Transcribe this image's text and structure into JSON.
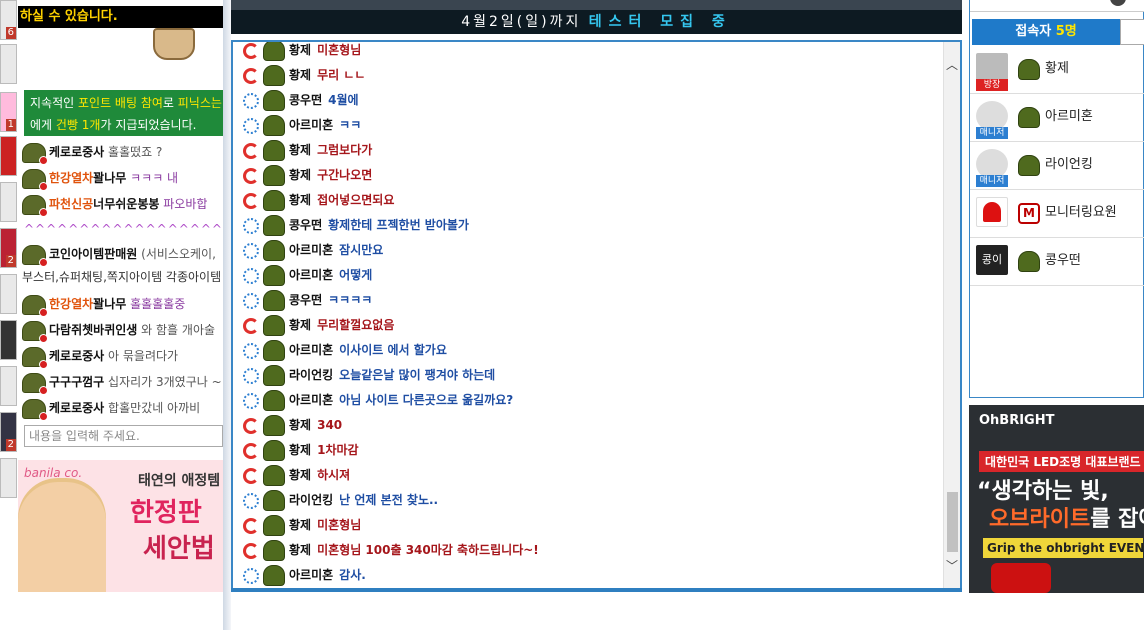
{
  "left": {
    "notice_top": "하실 수 있습니다.",
    "badges": [
      "6",
      "1",
      "2",
      "2"
    ],
    "green_notice": {
      "line1_prefix": "지속적인 ",
      "line1_hl": "포인트 배팅 참여",
      "line1_mid": "로 ",
      "line1_hl2": "피닉스는",
      "line2_prefix": "에게 ",
      "line2_hl": "건빵 1개",
      "line2_suffix": "가 지급되었습니다."
    },
    "messages": [
      {
        "name": "케로로중사",
        "msg": "홀홀떴죠 ?",
        "orange": false,
        "pink": false
      },
      {
        "name": "한강열차",
        "name2": "꽐나무",
        "msg": "ㅋㅋㅋ 내",
        "orange": true,
        "pink": true
      },
      {
        "name": "파천신공",
        "name2": "너무쉬운봉봉",
        "msg": "파오바합",
        "orange": true,
        "pink": true
      },
      {
        "name": "코인아이템판매원",
        "msg": "(서비스오케이,",
        "orange": false,
        "pink": false
      },
      {
        "name": "한강열차",
        "name2": "꽐나무",
        "msg": "홀홀홀홀중",
        "orange": true,
        "pink": true
      },
      {
        "name": "다람쥐쳇바퀴인생",
        "msg": "와 함흘 개아술",
        "orange": false,
        "pink": false
      },
      {
        "name": "케로로중사",
        "msg": "아 묶을려다가",
        "orange": false,
        "pink": false
      },
      {
        "name": "구구구껌구",
        "msg": "십자리가 3개였구나 ~",
        "orange": false,
        "pink": false
      },
      {
        "name": "케로로중사",
        "msg": "합홀만갔네 아까비",
        "orange": false,
        "pink": false
      }
    ],
    "carets": "^^^^^^^^^^^^^^^^^^^^",
    "plain_line": "부스터,슈퍼채팅,쪽지아이템 각종아이템",
    "input_placeholder": "내용을 입력해 주세요.",
    "ad": {
      "brand": "banila co.",
      "line1": "태연의 애정템",
      "line2": "한정판",
      "line3": "세안법"
    }
  },
  "header": {
    "date_text": "4월2일(일)까지",
    "highlight": "테스터 모집 중"
  },
  "chat": [
    {
      "icon": "red",
      "name": "황제",
      "msg": "미혼형님",
      "color": "r"
    },
    {
      "icon": "red",
      "name": "황제",
      "msg": "무리 ㄴㄴ",
      "color": "r"
    },
    {
      "icon": "blue",
      "name": "콩우떤",
      "msg": "4월에",
      "color": "b"
    },
    {
      "icon": "blue",
      "name": "아르미혼",
      "msg": "ㅋㅋ",
      "color": "b"
    },
    {
      "icon": "red",
      "name": "황제",
      "msg": "그럼보다가",
      "color": "r"
    },
    {
      "icon": "red",
      "name": "황제",
      "msg": "구간나오면",
      "color": "r"
    },
    {
      "icon": "red",
      "name": "황제",
      "msg": "접어넣으면되요",
      "color": "r"
    },
    {
      "icon": "blue",
      "name": "콩우떤",
      "msg": "황제한테 프젝한번 받아볼가",
      "color": "b"
    },
    {
      "icon": "blue",
      "name": "아르미혼",
      "msg": "잠시만요",
      "color": "b"
    },
    {
      "icon": "blue",
      "name": "아르미혼",
      "msg": "어떻게",
      "color": "b"
    },
    {
      "icon": "blue",
      "name": "콩우떤",
      "msg": "ㅋㅋㅋㅋ",
      "color": "b"
    },
    {
      "icon": "red",
      "name": "황제",
      "msg": "무리할껄요없음",
      "color": "r"
    },
    {
      "icon": "blue",
      "name": "아르미혼",
      "msg": "이사이트 에서 할가요",
      "color": "b"
    },
    {
      "icon": "blue",
      "name": "라이언킹",
      "msg": "오늘같은날 많이 팽겨야 하는데",
      "color": "b"
    },
    {
      "icon": "blue",
      "name": "아르미혼",
      "msg": "아님 사이트 다른곳으로 옮길까요?",
      "color": "b"
    },
    {
      "icon": "red",
      "name": "황제",
      "msg": "340",
      "color": "r"
    },
    {
      "icon": "red",
      "name": "황제",
      "msg": "1차마감",
      "color": "r"
    },
    {
      "icon": "red",
      "name": "황제",
      "msg": "하시져",
      "color": "r"
    },
    {
      "icon": "blue",
      "name": "라이언킹",
      "msg": "난 언제 본전 찾노..",
      "color": "b"
    },
    {
      "icon": "red",
      "name": "황제",
      "msg": "미혼형님",
      "color": "r"
    },
    {
      "icon": "red",
      "name": "황제",
      "msg": "미혼형님 100출 340마감 축하드립니다~!",
      "color": "r"
    },
    {
      "icon": "blue",
      "name": "아르미혼",
      "msg": "감사.",
      "color": "b"
    }
  ],
  "users_panel": {
    "tab_label": "접속자",
    "count": "5명",
    "users": [
      {
        "name": "황제",
        "label": "방장",
        "label_color": "red",
        "rank": "rank"
      },
      {
        "name": "아르미혼",
        "label": "매니저",
        "label_color": "blue",
        "rank": "rank"
      },
      {
        "name": "라이언킹",
        "label": "매니저",
        "label_color": "blue",
        "rank": "rank"
      },
      {
        "name": "모니터링요원",
        "label": "",
        "label_color": "",
        "rank": "M"
      },
      {
        "name": "콩우떤",
        "label": "",
        "label_color": "",
        "rank": "rank"
      }
    ]
  },
  "right_ad": {
    "logo": "OhBRIGHT",
    "tag": "대한민국 LED조명 대표브랜드",
    "quote1": "“생각하는 빛,",
    "quote2_hl": "오브라이트",
    "quote2_rest": "를 잡아",
    "event": "Grip the ohbright EVENT"
  },
  "colors": {
    "accent": "#1f7ac9",
    "chat_red": "#a5161b",
    "chat_blue": "#1f4ea3",
    "notice_green": "#1f8a3a"
  }
}
